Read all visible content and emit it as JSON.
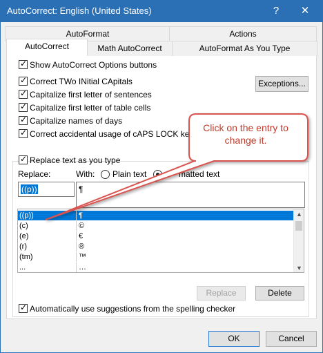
{
  "window": {
    "title": "AutoCorrect: English (United States)",
    "help_glyph": "?",
    "close_glyph": "✕"
  },
  "tabs": {
    "row1": [
      "AutoFormat",
      "Actions"
    ],
    "row2": [
      "AutoCorrect",
      "Math AutoCorrect",
      "AutoFormat As You Type"
    ],
    "active": "AutoCorrect"
  },
  "options": {
    "show_buttons": {
      "label": "Show AutoCorrect Options buttons",
      "checked": true
    },
    "two_initial_caps": {
      "label": "Correct TWo INitial CApitals",
      "checked": true
    },
    "cap_first_sentence": {
      "label": "Capitalize first letter of sentences",
      "checked": true
    },
    "cap_first_table": {
      "label": "Capitalize first letter of table cells",
      "checked": true
    },
    "cap_days": {
      "label": "Capitalize names of days",
      "checked": true
    },
    "caps_lock": {
      "label": "Correct accidental usage of cAPS LOCK key",
      "checked": true
    },
    "replace_as_you_type": {
      "label": "Replace text as you type",
      "checked": true
    },
    "spelling_suggestions": {
      "label": "Automatically use suggestions from the spelling checker",
      "checked": true
    }
  },
  "buttons": {
    "exceptions": "Exceptions...",
    "replace": "Replace",
    "delete": "Delete",
    "ok": "OK",
    "cancel": "Cancel"
  },
  "replace_section": {
    "replace_label": "Replace:",
    "with_label": "With:",
    "plain_text_label": "Plain text",
    "formatted_text_label_visible": "matted text",
    "formatted_selected": true,
    "replace_value": "((p))",
    "with_value": "¶"
  },
  "list": {
    "rows": [
      {
        "replace": "((p))",
        "with": "¶",
        "selected": true
      },
      {
        "replace": "(c)",
        "with": "©",
        "selected": false
      },
      {
        "replace": "(e)",
        "with": "€",
        "selected": false
      },
      {
        "replace": "(r)",
        "with": "®",
        "selected": false
      },
      {
        "replace": "(tm)",
        "with": "™",
        "selected": false
      },
      {
        "replace": "...",
        "with": "…",
        "selected": false
      }
    ]
  },
  "callout": {
    "text": "Click on the entry to change it.",
    "color": "#d9534f"
  },
  "checkmark": "✓",
  "icons": {
    "help": "help-icon",
    "close": "close-icon",
    "scroll_up": "scroll-up-icon",
    "scroll_down": "scroll-down-icon"
  }
}
